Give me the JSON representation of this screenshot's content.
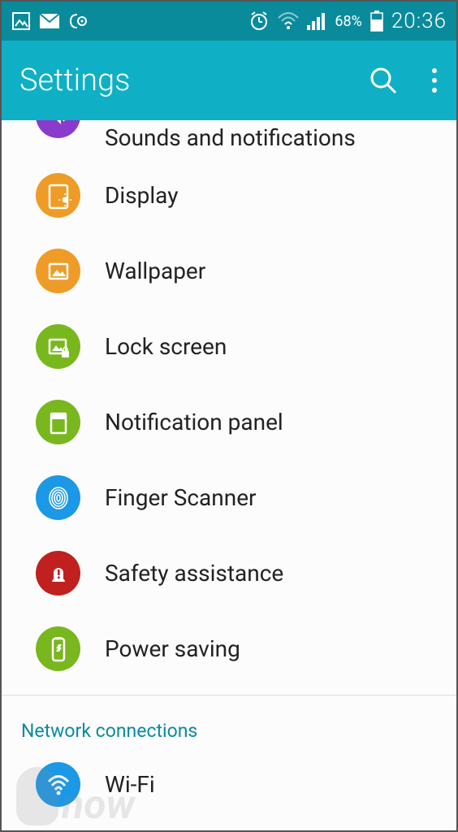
{
  "statusbar": {
    "time": "20:36",
    "battery_pct": "68%",
    "icons_left": [
      "image-icon",
      "mail-icon",
      "beam-icon"
    ],
    "icons_right": [
      "alarm-icon",
      "wifi-icon",
      "signal-icon",
      "battery-icon"
    ]
  },
  "appbar": {
    "title": "Settings"
  },
  "settings": {
    "items": [
      {
        "id": "sounds",
        "label": "Sounds and notifications",
        "color": "purple",
        "icon": "volume-icon",
        "cut": true
      },
      {
        "id": "display",
        "label": "Display",
        "color": "orange",
        "icon": "display-icon"
      },
      {
        "id": "wallpaper",
        "label": "Wallpaper",
        "color": "orange",
        "icon": "picture-icon"
      },
      {
        "id": "lockscreen",
        "label": "Lock screen",
        "color": "green",
        "icon": "lock-picture-icon"
      },
      {
        "id": "notifpanel",
        "label": "Notification panel",
        "color": "green",
        "icon": "panel-icon"
      },
      {
        "id": "fingerprint",
        "label": "Finger Scanner",
        "color": "blue",
        "icon": "fingerprint-icon"
      },
      {
        "id": "safety",
        "label": "Safety assistance",
        "color": "red",
        "icon": "alert-icon"
      },
      {
        "id": "powersaving",
        "label": "Power saving",
        "color": "green",
        "icon": "recycle-icon"
      }
    ],
    "section2_title": "Network connections",
    "wifi_label": "Wi-Fi"
  }
}
